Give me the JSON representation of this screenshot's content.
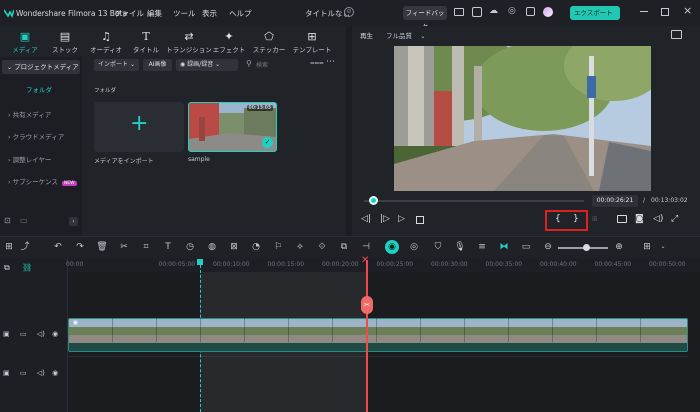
{
  "app": {
    "title": "Wondershare Filmora 13 Beta"
  },
  "menu": [
    "ファイル",
    "編集",
    "ツール",
    "表示",
    "ヘルプ"
  ],
  "titlebar": {
    "doc_title": "タイトルなし",
    "feedback": "フィードバック",
    "export": "エクスポート"
  },
  "toolbar": [
    "メディア",
    "ストック",
    "オーディオ",
    "タイトル",
    "トランジション",
    "エフェクト",
    "ステッカー",
    "テンプレート"
  ],
  "sidebar": {
    "project_media": "プロジェクトメディア",
    "folder": "フォルダ",
    "items": [
      "共有メディア",
      "クラウドメディア",
      "調整レイヤー",
      "サブシーケンス"
    ],
    "new_badge": "NEW"
  },
  "media_bar": {
    "import": "インポート",
    "ai_image": "AI画像",
    "record": "録画/録音",
    "search_placeholder": "検索"
  },
  "media_area": {
    "folder_label": "フォルダ",
    "import_tile_label": "メディアをインポート",
    "clip_label": "sample",
    "clip_duration": "00:13:03"
  },
  "preview": {
    "tab_play": "再生",
    "quality": "フル品質",
    "current_time": "00:00:26:21",
    "total_time": "00:13:03:02",
    "separator": "/",
    "mark_in": "{",
    "mark_out": "}"
  },
  "timeline": {
    "ruler_labels": [
      "00:00",
      "00:00:05:00",
      "00:00:10:00",
      "00:00:15:00",
      "00:00:20:00",
      "00:00:25:00",
      "00:00:30:00",
      "00:00:35:00",
      "00:00:40:00",
      "00:00:45:00",
      "00:00:50:00",
      "00:00:55"
    ]
  },
  "colors": {
    "accent": "#1fd1c1",
    "export_bg": "#21c8b4",
    "playhead": "#f04a4a",
    "highlight_box": "#e02020"
  }
}
